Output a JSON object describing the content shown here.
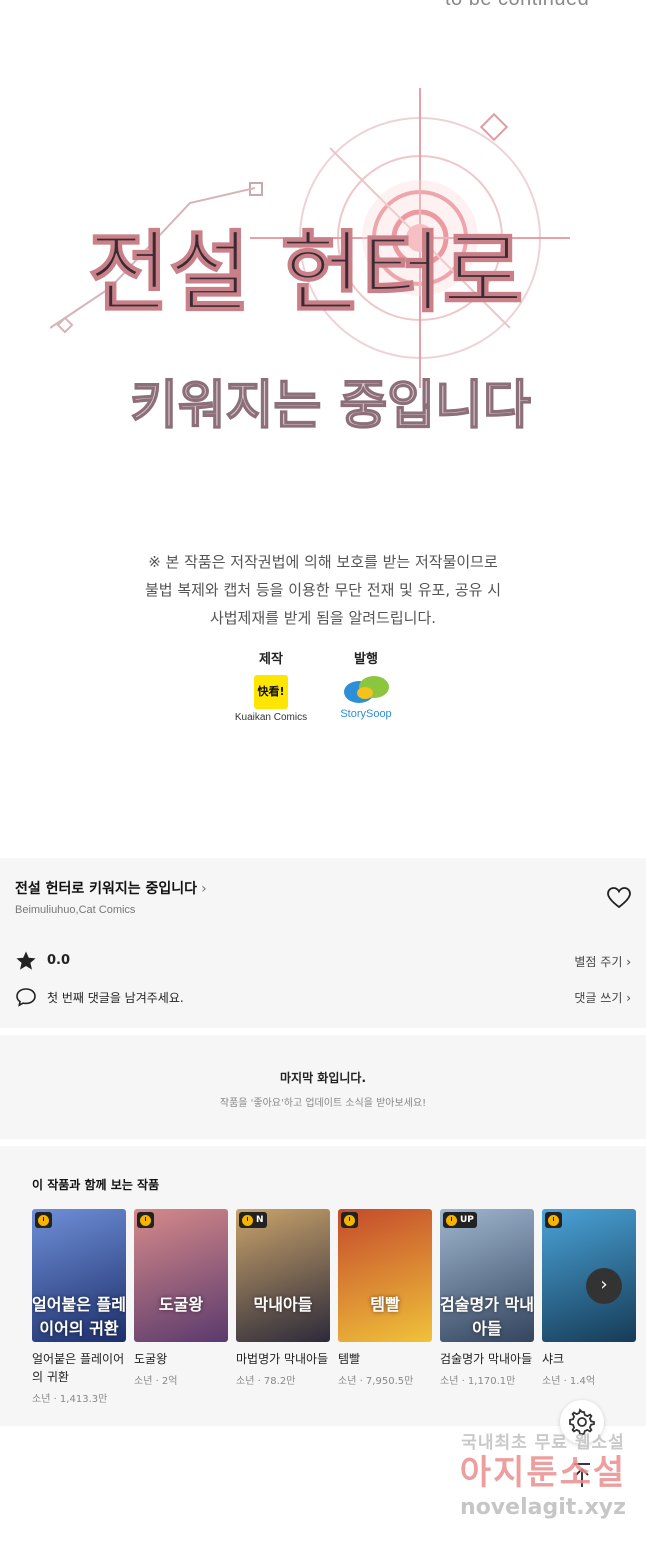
{
  "comic": {
    "to_be_continued": "to be continued",
    "title_line1": "전설 헌터로",
    "title_line2": "키워지는 중입니다",
    "notice_lines": [
      "※ 본 작품은 저작권법에 의해 보호를 받는 저작물이므로",
      "불법 복제와 캡처 등을 이용한 무단 전재 및 유포, 공유 시",
      "사법제재를 받게 됨을 알려드립니다."
    ],
    "production_label": "제작",
    "production_name": "Kuaikan Comics",
    "production_logo_text": "快看!",
    "publisher_label": "발행",
    "publisher_name": "StorySoop"
  },
  "info": {
    "title": "전설 헌터로 키워지는 중입니다",
    "authors": "Beimuliuhuo,Cat Comics",
    "rating": "0.0",
    "rate_action": "별점 주기",
    "comment_prompt": "첫 번째 댓글을 남겨주세요.",
    "comment_action": "댓글 쓰기"
  },
  "last_episode": {
    "title": "마지막 화입니다.",
    "subtitle": "작품을 '좋아요'하고 업데이트 소식을 받아보세요!"
  },
  "recommendations": {
    "heading": "이 작품과 함께 보는 작품",
    "items": [
      {
        "name": "얼어붙은 플레이어의 귀환",
        "meta": "소년 · 1,413.3만",
        "badge": "",
        "art_text": "얼어붙은 플레이어의 귀환",
        "colors": [
          "#1d2f6b",
          "#6f8fd8"
        ]
      },
      {
        "name": "도굴왕",
        "meta": "소년 · 2억",
        "badge": "",
        "art_text": "도굴왕",
        "colors": [
          "#5a3a6d",
          "#d68a8a"
        ]
      },
      {
        "name": "마법명가 막내아들",
        "meta": "소년 · 78.2만",
        "badge": "N",
        "art_text": "막내아들",
        "colors": [
          "#2c2a3a",
          "#c9a36b"
        ]
      },
      {
        "name": "템빨",
        "meta": "소년 · 7,950.5만",
        "badge": "",
        "art_text": "템빨",
        "colors": [
          "#f0c23a",
          "#c44a2c"
        ]
      },
      {
        "name": "검술명가 막내아들",
        "meta": "소년 · 1,170.1만",
        "badge": "UP",
        "art_text": "검술명가 막내아들",
        "colors": [
          "#34455e",
          "#9fb6cf"
        ]
      },
      {
        "name": "샤크",
        "meta": "소년 · 1.4억",
        "badge": "",
        "art_text": "",
        "colors": [
          "#163b56",
          "#4aa3d8"
        ]
      }
    ]
  },
  "watermark": {
    "line1": "국내최초 무료 웹소설",
    "line2": "아지툰소설",
    "line3": "novelagit.xyz"
  }
}
